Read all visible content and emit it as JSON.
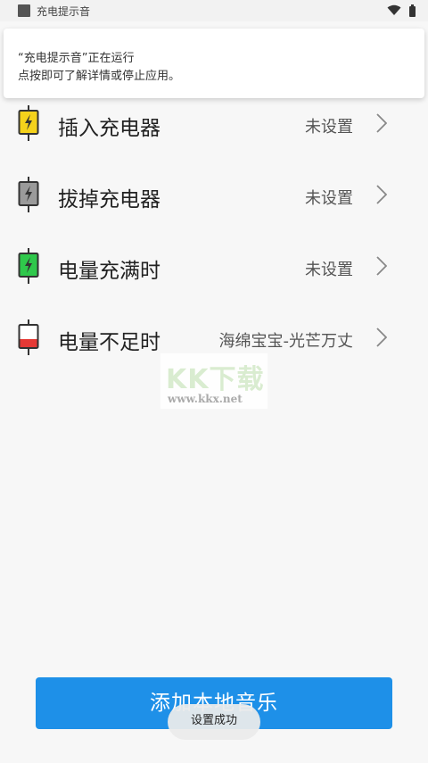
{
  "status_bar": {
    "app_title": "充电提示音",
    "icons": [
      "app-icon",
      "wifi-icon",
      "battery-icon"
    ]
  },
  "notification": {
    "line1": "“充电提示音”正在运行",
    "line2": "点按即可了解详情或停止应用。"
  },
  "settings": {
    "items": [
      {
        "label": "插入充电器",
        "value": "未设置",
        "icon": "plug-in-charger-icon",
        "icon_color": "#f5d21b"
      },
      {
        "label": "拔掉充电器",
        "value": "未设置",
        "icon": "unplug-charger-icon",
        "icon_color": "#9a9a9a"
      },
      {
        "label": "电量充满时",
        "value": "未设置",
        "icon": "battery-full-icon",
        "icon_color": "#2fc84b"
      },
      {
        "label": "电量不足时",
        "value": "海绵宝宝-光芒万丈",
        "icon": "battery-low-icon",
        "icon_color": "#e53935"
      }
    ]
  },
  "watermark": {
    "title": "KK下载",
    "url": "www.kkx.net"
  },
  "actions": {
    "add_music_label": "添加本地音乐"
  },
  "toast": {
    "message": "设置成功"
  },
  "colors": {
    "accent": "#1e90e8",
    "background": "#f7f7f7"
  }
}
